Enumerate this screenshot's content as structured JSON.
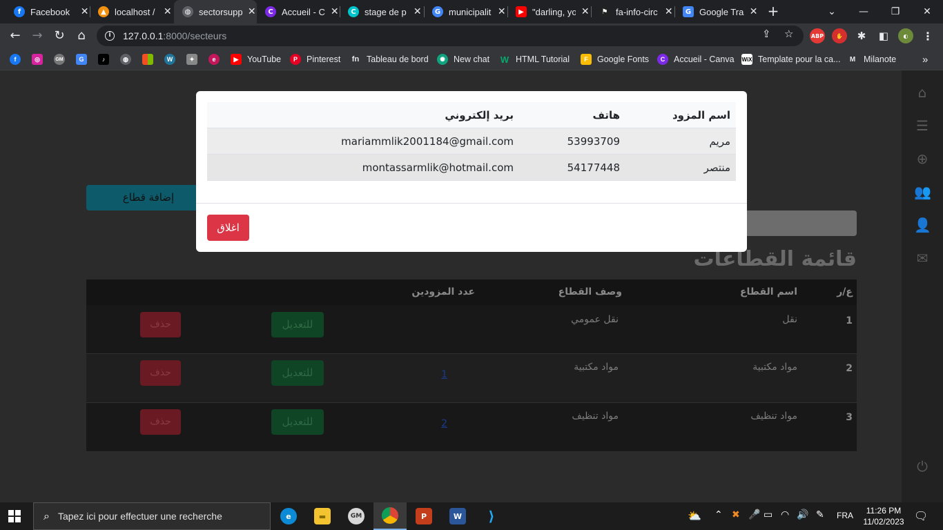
{
  "browser": {
    "tabs": [
      {
        "title": "Facebook",
        "icon": "facebook-icon",
        "color": "#1877f2",
        "glyph": "f",
        "active": false
      },
      {
        "title": "localhost /",
        "icon": "phpmyadmin-icon",
        "color": "#f29111",
        "glyph": "▲",
        "active": false
      },
      {
        "title": "sectorsupp",
        "icon": "globe-icon",
        "color": "#5f6368",
        "glyph": "◍",
        "active": true
      },
      {
        "title": "Accueil - C",
        "icon": "canva-icon",
        "color": "#7d2ae8",
        "glyph": "C",
        "active": false
      },
      {
        "title": "stage de p",
        "icon": "canva-icon",
        "color": "#00c4cc",
        "glyph": "C",
        "active": false
      },
      {
        "title": "municipalit",
        "icon": "google-icon",
        "color": "#4285f4",
        "glyph": "G",
        "active": false
      },
      {
        "title": "\"darling, yo",
        "icon": "youtube-icon",
        "color": "#ff0000",
        "glyph": "▶",
        "active": false
      },
      {
        "title": "fa-info-circ",
        "icon": "flag-icon",
        "color": "#222222",
        "glyph": "⚑",
        "active": false
      },
      {
        "title": "Google Tra",
        "icon": "google-translate-icon",
        "color": "#4285f4",
        "glyph": "G",
        "active": false
      }
    ],
    "url_host": "127.0.0.1",
    "url_rest": ":8000/secteurs",
    "bookmarks": [
      {
        "label": "",
        "icon": "facebook-icon",
        "color": "#1877f2",
        "glyph": "f"
      },
      {
        "label": "",
        "icon": "instagram-icon",
        "color": "#d6249f",
        "glyph": "◎"
      },
      {
        "label": "",
        "icon": "gm-icon",
        "color": "#777777",
        "glyph": "GM"
      },
      {
        "label": "",
        "icon": "google-translate-icon",
        "color": "#4285f4",
        "glyph": "G"
      },
      {
        "label": "",
        "icon": "tiktok-icon",
        "color": "#000000",
        "glyph": "♪"
      },
      {
        "label": "",
        "icon": "globe-icon",
        "color": "#5f6368",
        "glyph": "◍"
      },
      {
        "label": "",
        "icon": "microsoft-icon",
        "color": "#f25022",
        "glyph": "■"
      },
      {
        "label": "",
        "icon": "wordpress-icon",
        "color": "#21759b",
        "glyph": "W"
      },
      {
        "label": "",
        "icon": "bird-icon",
        "color": "#888888",
        "glyph": "✦"
      },
      {
        "label": "",
        "icon": "circle-e-icon",
        "color": "#c2185b",
        "glyph": "e"
      },
      {
        "label": "YouTube",
        "icon": "youtube-icon",
        "color": "#ff0000",
        "glyph": "▶"
      },
      {
        "label": "Pinterest",
        "icon": "pinterest-icon",
        "color": "#e60023",
        "glyph": "P"
      },
      {
        "label": "Tableau de bord",
        "icon": "fn-icon",
        "color": "#35363a",
        "glyph": "fn"
      },
      {
        "label": "New chat",
        "icon": "openai-icon",
        "color": "#10a37f",
        "glyph": "✺"
      },
      {
        "label": "HTML Tutorial",
        "icon": "w3schools-icon",
        "color": "#04aa6d",
        "glyph": "W"
      },
      {
        "label": "Google Fonts",
        "icon": "google-fonts-icon",
        "color": "#fbbc04",
        "glyph": "F"
      },
      {
        "label": "Accueil - Canva",
        "icon": "canva-icon",
        "color": "#7d2ae8",
        "glyph": "C"
      },
      {
        "label": "Template pour la ca...",
        "icon": "wix-icon",
        "color": "#000000",
        "glyph": "W"
      },
      {
        "label": "Milanote",
        "icon": "milanote-icon",
        "color": "#35363a",
        "glyph": "M"
      }
    ],
    "more_glyph": "»"
  },
  "page": {
    "add_button": "إضافة قطاع",
    "title": "قائمة القطاعات",
    "table": {
      "headers": [
        "ع/ر",
        "اسم القطاع",
        "وصف القطاع",
        "عدد المزودين"
      ],
      "rows": [
        {
          "num": "1",
          "name": "نقل",
          "desc": "نقل عمومي",
          "count": "",
          "edit": "للتعديل",
          "delete": "حذف"
        },
        {
          "num": "2",
          "name": "مواد مكتبية",
          "desc": "مواد مكتبية",
          "count": "1",
          "edit": "للتعديل",
          "delete": "حذف"
        },
        {
          "num": "3",
          "name": "مواد تنظيف",
          "desc": "مواد تنظيف",
          "count": "2",
          "edit": "للتعديل",
          "delete": "حذف"
        }
      ]
    }
  },
  "modal": {
    "headers": [
      "اسم المزود",
      "هاتف",
      "بريد إلكتروني"
    ],
    "rows": [
      {
        "name": "مريم",
        "phone": "53993709",
        "email": "mariammlik2001184@gmail.com"
      },
      {
        "name": "منتصر",
        "phone": "54177448",
        "email": "montassarmlik@hotmail.com"
      }
    ],
    "close_button": "اغلاق",
    "close_color": "#dc3545"
  },
  "taskbar": {
    "search_placeholder": "Tapez ici pour effectuer une recherche",
    "language": "FRA",
    "time": "11:26 PM",
    "date": "11/02/2023"
  }
}
